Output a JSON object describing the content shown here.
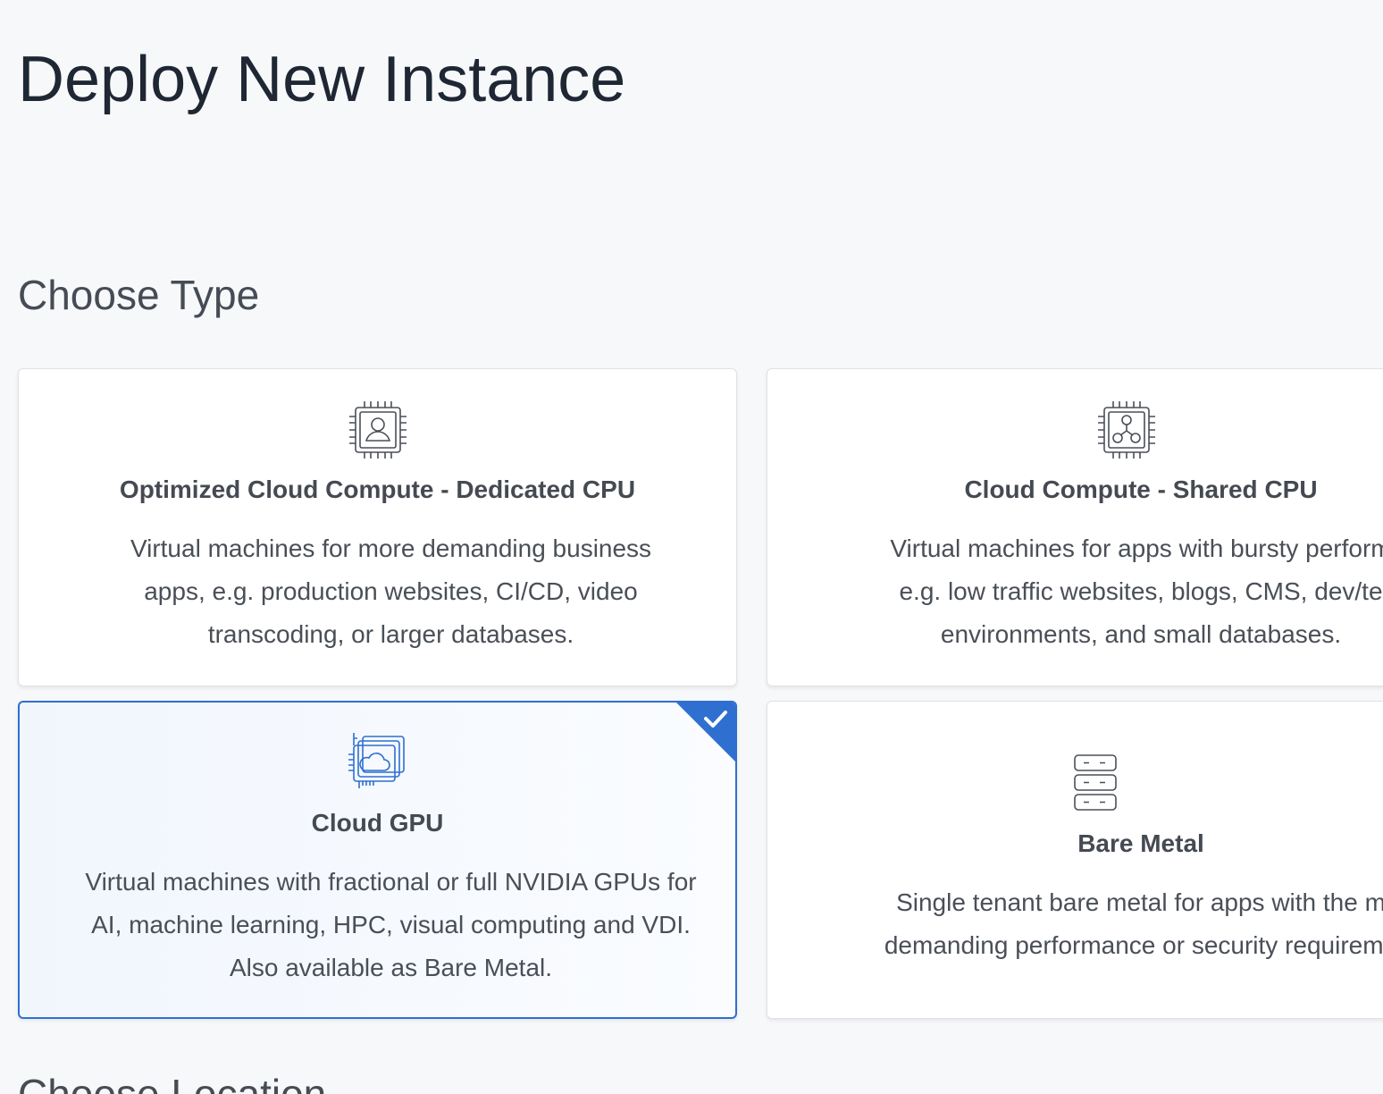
{
  "page_title": "Deploy New Instance",
  "choose_type": {
    "heading": "Choose Type",
    "cards": [
      {
        "title": "Optimized Cloud Compute - Dedicated CPU",
        "description": "Virtual machines for more demanding business apps, e.g. production websites, CI/CD, video transcoding, or larger databases.",
        "icon": "cpu-user-icon",
        "selected": false
      },
      {
        "title": "Cloud Compute - Shared CPU",
        "description_lines": [
          "Virtual machines for apps with bursty perform",
          "e.g. low traffic websites, blogs, CMS, dev/te",
          "environments, and small databases."
        ],
        "icon": "cpu-share-icon",
        "selected": false
      },
      {
        "title": "Cloud GPU",
        "description": "Virtual machines with fractional or full NVIDIA GPUs for AI, machine learning, HPC, visual computing and VDI. Also available as Bare Metal.",
        "icon": "gpu-cloud-icon",
        "selected": true
      },
      {
        "title": "Bare Metal",
        "description_lines": [
          "Single tenant bare metal for apps with the m",
          "demanding performance or security requireme"
        ],
        "icon": "server-stack-icon",
        "selected": false
      }
    ]
  },
  "choose_location": {
    "heading": "Choose Location"
  },
  "colors": {
    "accent": "#2f6fcf",
    "selected_background": "#f1f6fd",
    "heading_text": "#1e2733",
    "body_text": "#4a4f57"
  }
}
